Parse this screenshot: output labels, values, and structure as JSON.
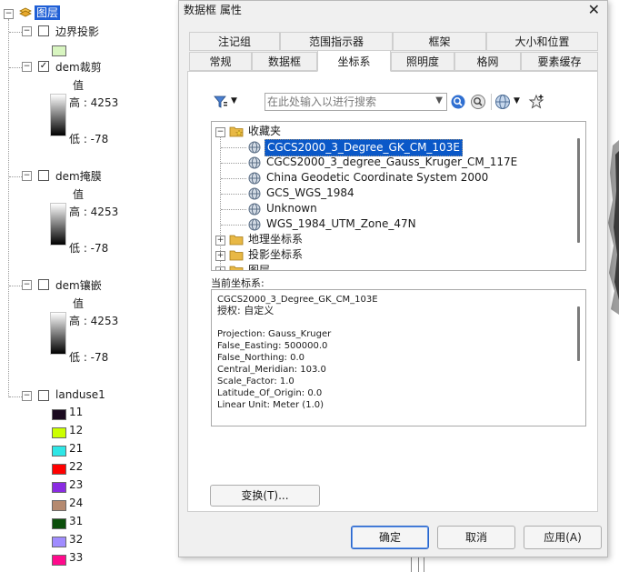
{
  "toc": {
    "root_label": "图层",
    "layers": [
      {
        "name": "边界投影",
        "checked": false
      },
      {
        "name": "dem裁剪",
        "checked": true,
        "value_label": "值",
        "high": "高 : 4253",
        "low": "低 : -78"
      },
      {
        "name": "dem掩膜",
        "checked": false,
        "value_label": "值",
        "high": "高 : 4253",
        "low": "低 : -78"
      },
      {
        "name": "dem镶嵌",
        "checked": false,
        "value_label": "值",
        "high": "高 : 4253",
        "low": "低 : -78"
      },
      {
        "name": "landuse1",
        "checked": false
      }
    ],
    "landuse_classes": [
      {
        "label": "11",
        "color": "#1a0a1f"
      },
      {
        "label": "12",
        "color": "#ccff00"
      },
      {
        "label": "21",
        "color": "#2ee6e6"
      },
      {
        "label": "22",
        "color": "#ff0000"
      },
      {
        "label": "23",
        "color": "#8a2be2"
      },
      {
        "label": "24",
        "color": "#b58a70"
      },
      {
        "label": "31",
        "color": "#0b4f0b"
      },
      {
        "label": "32",
        "color": "#a08cff"
      },
      {
        "label": "33",
        "color": "#ff0a8c"
      }
    ],
    "boundary_swatch_color": "#d8f5c0"
  },
  "dialog": {
    "title": "数据框 属性",
    "tabs_row1": [
      "注记组",
      "范围指示器",
      "框架",
      "大小和位置"
    ],
    "tabs_row2": [
      "常规",
      "数据框",
      "坐标系",
      "照明度",
      "格网",
      "要素缓存"
    ],
    "active_tab": "坐标系",
    "search_placeholder": "在此处输入以进行搜索",
    "tree": {
      "favorites_label": "收藏夹",
      "items": [
        "CGCS2000_3_Degree_GK_CM_103E",
        "CGCS2000_3_degree_Gauss_Kruger_CM_117E",
        "China Geodetic Coordinate System 2000",
        "GCS_WGS_1984",
        "Unknown",
        "WGS_1984_UTM_Zone_47N"
      ],
      "selected_item": "CGCS2000_3_Degree_GK_CM_103E",
      "folders": [
        "地理坐标系",
        "投影坐标系",
        "图层"
      ]
    },
    "current_cs_label": "当前坐标系:",
    "current_cs": {
      "name": "CGCS2000_3_Degree_GK_CM_103E",
      "authority": "授权: 自定义",
      "details": [
        "Projection: Gauss_Kruger",
        "False_Easting: 500000.0",
        "False_Northing: 0.0",
        "Central_Meridian: 103.0",
        "Scale_Factor: 1.0",
        "Latitude_Of_Origin: 0.0",
        "Linear Unit: Meter (1.0)"
      ]
    },
    "transform_button": "变换(T)...",
    "ok_button": "确定",
    "cancel_button": "取消",
    "apply_button": "应用(A)"
  }
}
